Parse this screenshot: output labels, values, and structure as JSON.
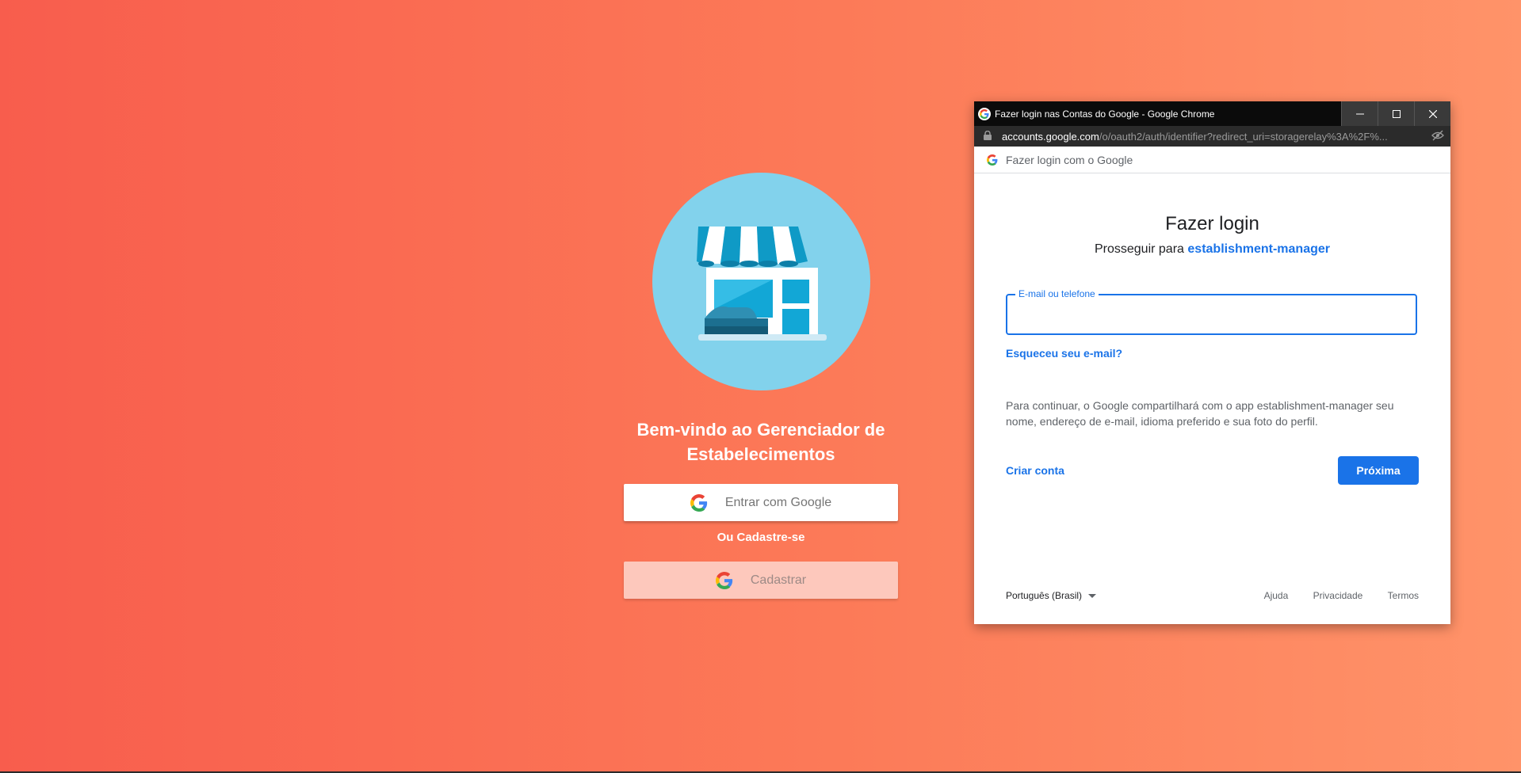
{
  "landing": {
    "welcome_line1": "Bem-vindo ao Gerenciador de",
    "welcome_line2": "Estabelecimentos",
    "google_button_label": "Entrar com Google",
    "or_register": "Ou Cadastre-se",
    "register_button_label": "Cadastrar",
    "logo_icon": "storefront-icon"
  },
  "popup": {
    "window_title": "Fazer login nas Contas do Google - Google Chrome",
    "url_domain": "accounts.google.com",
    "url_path": "/o/oauth2/auth/identifier?redirect_uri=storagerelay%3A%2F%...",
    "header_text": "Fazer login com o Google",
    "title": "Fazer login",
    "subtitle_prefix": "Prosseguir para",
    "app_name": "establishment-manager",
    "email_label": "E-mail ou telefone",
    "email_value": "",
    "forgot_email": "Esqueceu seu e-mail?",
    "consent_text": "Para continuar, o Google compartilhará com o app establishment-manager seu nome, endereço de e-mail, idioma preferido e sua foto do perfil.",
    "create_account": "Criar conta",
    "next_button": "Próxima",
    "language": "Português (Brasil)",
    "footer_links": [
      "Ajuda",
      "Privacidade",
      "Termos"
    ]
  },
  "colors": {
    "accent_blue": "#1a73e8",
    "background_start": "#f85d4d",
    "background_end": "#ff9369",
    "logo_circle": "#82d2ec"
  }
}
